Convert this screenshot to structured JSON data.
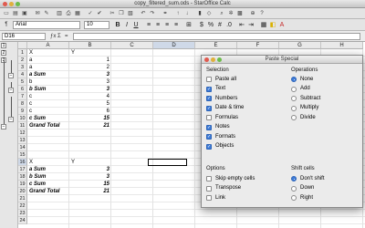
{
  "window": {
    "title": "copy_filtered_sum.ods - StarOffice Calc"
  },
  "toolbar": {
    "font_name": "Arial",
    "font_size": "10",
    "bold": "B",
    "italic": "I",
    "underline": "U"
  },
  "formula_bar": {
    "cell_ref": "D16",
    "fx": "ƒx",
    "sum": "Σ",
    "eq": "="
  },
  "outline": {
    "levels": [
      "1",
      "2",
      "3"
    ]
  },
  "sheet": {
    "columns": [
      "A",
      "B",
      "C",
      "D",
      "E",
      "F",
      "G",
      "H"
    ],
    "rows": [
      "1",
      "2",
      "3",
      "4",
      "5",
      "6",
      "7",
      "8",
      "9",
      "10",
      "11",
      "12",
      "13",
      "14",
      "15",
      "16",
      "17",
      "18",
      "19",
      "20",
      "21",
      "22",
      "23",
      "24"
    ],
    "cells": [
      {
        "ref": "A1",
        "value": "X"
      },
      {
        "ref": "B1",
        "value": "Y"
      },
      {
        "ref": "A2",
        "value": "a"
      },
      {
        "ref": "B2",
        "value": "1"
      },
      {
        "ref": "A3",
        "value": "a"
      },
      {
        "ref": "B3",
        "value": "2"
      },
      {
        "ref": "A4",
        "value": "a Sum"
      },
      {
        "ref": "B4",
        "value": "3"
      },
      {
        "ref": "A5",
        "value": "b"
      },
      {
        "ref": "B5",
        "value": "3"
      },
      {
        "ref": "A6",
        "value": "b Sum"
      },
      {
        "ref": "B6",
        "value": "3"
      },
      {
        "ref": "A7",
        "value": "c"
      },
      {
        "ref": "B7",
        "value": "4"
      },
      {
        "ref": "A8",
        "value": "c"
      },
      {
        "ref": "B8",
        "value": "5"
      },
      {
        "ref": "A9",
        "value": "c"
      },
      {
        "ref": "B9",
        "value": "6"
      },
      {
        "ref": "A10",
        "value": "c Sum"
      },
      {
        "ref": "B10",
        "value": "15"
      },
      {
        "ref": "A11",
        "value": "Grand Total"
      },
      {
        "ref": "B11",
        "value": "21"
      },
      {
        "ref": "A16",
        "value": "X"
      },
      {
        "ref": "B16",
        "value": "Y"
      },
      {
        "ref": "A17",
        "value": "a Sum"
      },
      {
        "ref": "B17",
        "value": "3"
      },
      {
        "ref": "A18",
        "value": "b Sum"
      },
      {
        "ref": "B18",
        "value": "3"
      },
      {
        "ref": "A19",
        "value": "c Sum"
      },
      {
        "ref": "B19",
        "value": "15"
      },
      {
        "ref": "A20",
        "value": "Grand Total"
      },
      {
        "ref": "B20",
        "value": "21"
      }
    ]
  },
  "dialog": {
    "title": "Paste Special",
    "selection": {
      "label": "Selection",
      "items": [
        {
          "label": "Paste all",
          "checked": false
        },
        {
          "label": "Text",
          "checked": true
        },
        {
          "label": "Numbers",
          "checked": true
        },
        {
          "label": "Date & time",
          "checked": true
        },
        {
          "label": "Formulas",
          "checked": false
        },
        {
          "label": "Notes",
          "checked": true
        },
        {
          "label": "Formats",
          "checked": true
        },
        {
          "label": "Objects",
          "checked": true
        }
      ]
    },
    "operations": {
      "label": "Operations",
      "items": [
        {
          "label": "None",
          "selected": true
        },
        {
          "label": "Add",
          "selected": false
        },
        {
          "label": "Subtract",
          "selected": false
        },
        {
          "label": "Multiply",
          "selected": false
        },
        {
          "label": "Divide",
          "selected": false
        }
      ]
    },
    "options": {
      "label": "Options",
      "items": [
        {
          "label": "Skip empty cells",
          "checked": false
        },
        {
          "label": "Transpose",
          "checked": false
        },
        {
          "label": "Link",
          "checked": false
        }
      ]
    },
    "shift_cells": {
      "label": "Shift cells",
      "items": [
        {
          "label": "Don't shift",
          "selected": true
        },
        {
          "label": "Down",
          "selected": false
        },
        {
          "label": "Right",
          "selected": false
        }
      ]
    }
  }
}
